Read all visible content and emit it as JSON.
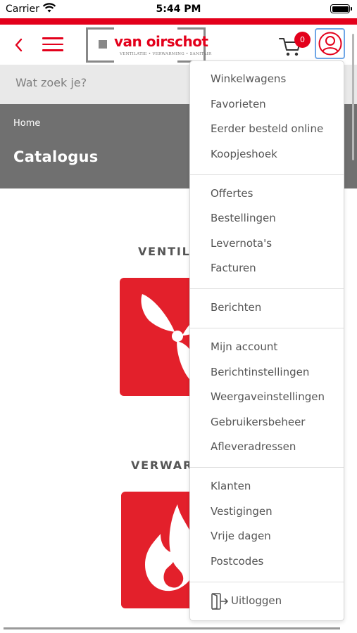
{
  "status_bar": {
    "carrier": "Carrier",
    "time": "5:44 PM"
  },
  "header": {
    "logo_name": "van oirschot",
    "logo_tagline": "VENTILATIE • VERWARMING • SANITAIR",
    "cart_count": "0"
  },
  "search": {
    "placeholder": "Wat zoek je?"
  },
  "hero": {
    "breadcrumb": "Home",
    "title": "Catalogus"
  },
  "categories": [
    {
      "title": "VENTIL",
      "icon": "fan-icon"
    },
    {
      "title": "VERWAR",
      "icon": "flame-icon"
    }
  ],
  "account_menu": {
    "groups": [
      {
        "items": [
          "Winkelwagens",
          "Favorieten",
          "Eerder besteld online",
          "Koopjeshoek"
        ]
      },
      {
        "items": [
          "Offertes",
          "Bestellingen",
          "Levernota's",
          "Facturen"
        ]
      },
      {
        "items": [
          "Berichten"
        ]
      },
      {
        "items": [
          "Mijn account",
          "Berichtinstellingen",
          "Weergaveinstellingen",
          "Gebruikersbeheer",
          "Afleveradressen"
        ]
      },
      {
        "items": [
          "Klanten",
          "Vestigingen",
          "Vrije dagen",
          "Postcodes"
        ]
      }
    ],
    "logout_label": "Uitloggen"
  },
  "colors": {
    "brand_red": "#e3001b",
    "hero_gray": "#707070",
    "focus_blue": "#6ea6e6"
  }
}
